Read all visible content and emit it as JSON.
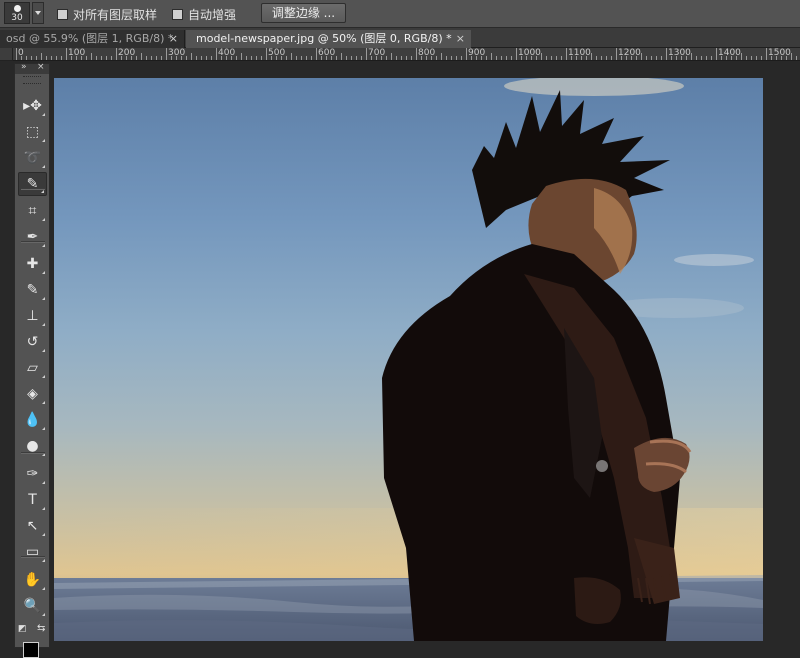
{
  "options_bar": {
    "brush_size": "30",
    "sample_all_layers_label": "对所有图层取样",
    "auto_enhance_label": "自动增强",
    "refine_edge_label": "调整边缘 ..."
  },
  "tabs": [
    {
      "label": "osd @ 55.9% (图层 1, RGB/8) *",
      "close": "×"
    },
    {
      "label": "model-newspaper.jpg @ 50% (图层 0, RGB/8) *",
      "close": "×"
    }
  ],
  "ruler": {
    "labels": [
      "0",
      "100",
      "200",
      "300",
      "400",
      "500",
      "600",
      "700",
      "800",
      "900",
      "1000",
      "1100",
      "1200",
      "1300",
      "1400",
      "1500"
    ]
  },
  "toolbox": {
    "collapse": "»",
    "close": "×",
    "tools": [
      {
        "name": "move-tool",
        "glyph": "▸✥"
      },
      {
        "name": "rectangular-marquee-tool",
        "glyph": "⬚"
      },
      {
        "name": "lasso-tool",
        "glyph": "➰"
      },
      {
        "name": "quick-selection-tool",
        "glyph": "✎"
      },
      {
        "name": "crop-tool",
        "glyph": "⌗"
      },
      {
        "name": "eyedropper-tool",
        "glyph": "✒"
      },
      {
        "name": "spot-healing-brush-tool",
        "glyph": "✚"
      },
      {
        "name": "brush-tool",
        "glyph": "✎"
      },
      {
        "name": "clone-stamp-tool",
        "glyph": "⊥"
      },
      {
        "name": "history-brush-tool",
        "glyph": "↺"
      },
      {
        "name": "eraser-tool",
        "glyph": "▱"
      },
      {
        "name": "paint-bucket-tool",
        "glyph": "◈"
      },
      {
        "name": "blur-tool",
        "glyph": "💧"
      },
      {
        "name": "dodge-tool",
        "glyph": "●"
      },
      {
        "name": "pen-tool",
        "glyph": "✑"
      },
      {
        "name": "type-tool",
        "glyph": "T"
      },
      {
        "name": "path-selection-tool",
        "glyph": "↖"
      },
      {
        "name": "rectangle-tool",
        "glyph": "▭"
      },
      {
        "name": "hand-tool",
        "glyph": "✋"
      },
      {
        "name": "zoom-tool",
        "glyph": "🔍"
      }
    ],
    "default_colors_glyph": "◩",
    "swap_colors_glyph": "⇆"
  },
  "colors": {
    "foreground": "#000000",
    "background": "#ffffff",
    "panel": "#535353",
    "workspace": "#282828"
  }
}
